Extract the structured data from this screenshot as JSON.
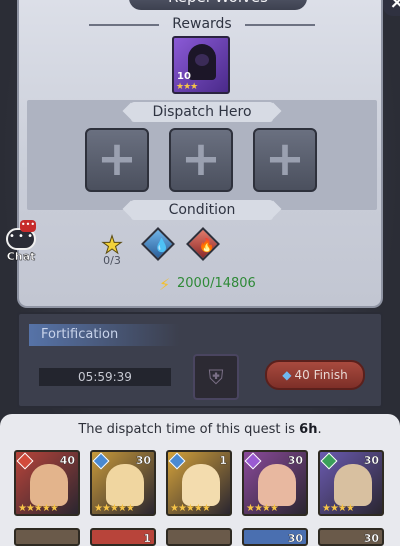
{
  "quest": {
    "title": "Repel Wolves",
    "close_label": "×",
    "rewards_label": "Rewards",
    "reward_item": {
      "level": "10",
      "stars": "★★★"
    },
    "dispatch_label": "Dispatch Hero",
    "slot_plus": "+",
    "condition_label": "Condition",
    "conditions": [
      {
        "icon": "star-icon",
        "value": "0/3"
      },
      {
        "icon": "water-element-icon"
      },
      {
        "icon": "fire-element-icon"
      }
    ],
    "power": "2000/14806"
  },
  "chat": {
    "label": "Chat",
    "badge": "•••"
  },
  "fortification": {
    "title": "Fortification",
    "timer": "05:59:39",
    "finish_label": "40 Finish"
  },
  "sheet": {
    "message_prefix": "The dispatch time of this quest is ",
    "message_time": "6h",
    "message_suffix": ".",
    "heroes": [
      {
        "level": "40",
        "stars": "★★★★★",
        "elem_color": "#d24a3a",
        "bg": "#b8443a",
        "portrait": "#e3b48c"
      },
      {
        "level": "30",
        "stars": "★★★★★",
        "elem_color": "#4a8ad2",
        "bg": "#c89a3a",
        "portrait": "#f0d6a0"
      },
      {
        "level": "1",
        "stars": "★★★★★",
        "elem_color": "#4a8ad2",
        "bg": "#d4a23a",
        "portrait": "#f3dcae"
      },
      {
        "level": "30",
        "stars": "★★★★",
        "elem_color": "#9a5ad2",
        "bg": "#8a4a9a",
        "portrait": "#e8b8a0"
      },
      {
        "level": "30",
        "stars": "★★★★",
        "elem_color": "#3aa05a",
        "bg": "#6a5ab0",
        "portrait": "#d8c0a0"
      }
    ],
    "heroes_row2": [
      {
        "level": ""
      },
      {
        "level": "1"
      },
      {
        "level": ""
      },
      {
        "level": "30"
      },
      {
        "level": "30"
      }
    ]
  }
}
